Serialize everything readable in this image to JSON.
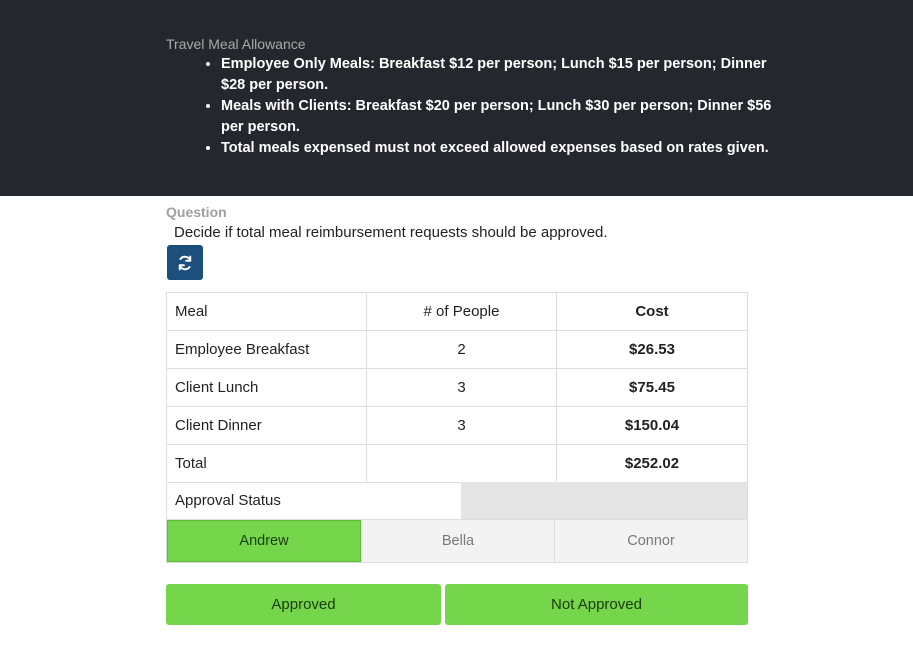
{
  "policy": {
    "title": "Travel Meal Allowance",
    "items": [
      "Employee Only Meals: Breakfast $12 per person; Lunch $15 per person; Dinner $28 per person.",
      "Meals with Clients: Breakfast $20 per person; Lunch $30 per person; Dinner $56 per person.",
      "Total meals expensed must not exceed allowed expenses based on rates given."
    ]
  },
  "question": {
    "label": "Question",
    "text": "Decide if total meal reimbursement requests should be approved."
  },
  "refresh": {
    "icon": "refresh-icon",
    "color": "#1d4f7c"
  },
  "table": {
    "headers": [
      "Meal",
      "# of People",
      "Cost"
    ],
    "rows": [
      {
        "meal": "Employee Breakfast",
        "people": "2",
        "cost": "$26.53"
      },
      {
        "meal": "Client Lunch",
        "people": "3",
        "cost": "$75.45"
      },
      {
        "meal": "Client Dinner",
        "people": "3",
        "cost": "$150.04"
      },
      {
        "meal": "Total",
        "people": "",
        "cost": "$252.02"
      }
    ],
    "approval_label": "Approval Status",
    "approval_value": ""
  },
  "people": [
    {
      "name": "Andrew",
      "selected": true
    },
    {
      "name": "Bella",
      "selected": false
    },
    {
      "name": "Connor",
      "selected": false
    }
  ],
  "buttons": {
    "approved": "Approved",
    "not_approved": "Not Approved"
  },
  "colors": {
    "header_bg": "#24272d",
    "accent_green": "#76d64b",
    "button_blue": "#1d4f7c"
  }
}
